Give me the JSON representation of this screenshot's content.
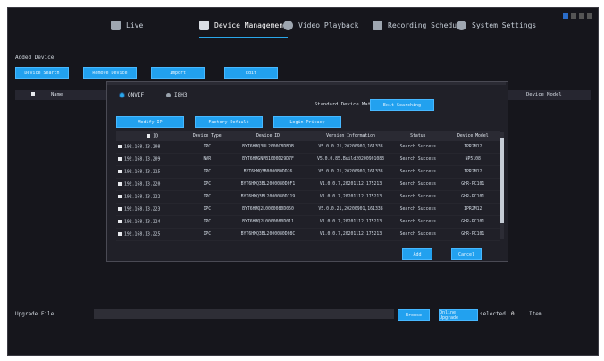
{
  "tabs": [
    {
      "label": "Live",
      "icon": "monitor-icon"
    },
    {
      "label": "Device Management",
      "icon": "grid-icon",
      "active": true
    },
    {
      "label": "Video Playback",
      "icon": "playback-icon"
    },
    {
      "label": "Recording Schedule",
      "icon": "schedule-icon"
    },
    {
      "label": "System Settings",
      "icon": "settings-icon"
    }
  ],
  "section": {
    "title": "Added Device"
  },
  "toolbar": {
    "add_label": "Device Search",
    "remove_label": "Remove Device",
    "import_label": "Import",
    "edit_label": "Edit"
  },
  "table": {
    "name_header": "Name",
    "model_header": "Device Model"
  },
  "bottom": {
    "label": "Upgrade File",
    "browse_label": "Browse",
    "upgrade_label": "Online Upgrade",
    "selected_label": "selected",
    "selected_count": "0",
    "unit": "Item"
  },
  "dialog": {
    "radio_onvif": "ONVIF",
    "radio_i8h": "I8H3",
    "standard_label": "Standard Device Match",
    "exit_label": "Exit Searching",
    "btn_modify_ip": "Modify IP",
    "btn_restore": "Factory Default",
    "btn_activate": "Login Privacy",
    "columns": [
      "ID",
      "Device Type",
      "Device ID",
      "Version Information",
      "Status",
      "Device Model"
    ],
    "rows": [
      [
        "192.168.13.208",
        "IPC",
        "BYT6HMQ3BL2000C8DBOB",
        "V5.0.0.21,20200901,161338",
        "Search Success",
        "IPR2M12"
      ],
      [
        "192.168.13.209",
        "NVR",
        "BYT6HMGNPB1000D29D7F",
        "V5.0.0.85.Build20200901083",
        "Search Success",
        "NP5108"
      ],
      [
        "192.168.13.215",
        "IPC",
        "BYT6HMQ3B0000B0DD26",
        "V5.0.0.21,20200901,161338",
        "Search Success",
        "IPR2M12"
      ],
      [
        "192.168.13.220",
        "IPC",
        "BYT6HMQ3BL2000080D0F1",
        "V1.0.0.7,20201112,175213",
        "Search Success",
        "GHR-PC101"
      ],
      [
        "192.168.13.222",
        "IPC",
        "BYT6HMQ3BL2000080D119",
        "V1.0.0.7,20201112,175213",
        "Search Success",
        "GHR-PC101"
      ],
      [
        "192.168.13.223",
        "IPC",
        "BYT6HMQ2L0000080D050",
        "V5.0.0.21,20200901,161338",
        "Search Success",
        "IPR2M12"
      ],
      [
        "192.168.13.224",
        "IPC",
        "BYT6HMQ2L0000080D011",
        "V1.0.0.7,20201112,175213",
        "Search Success",
        "GHR-PC101"
      ],
      [
        "192.168.13.225",
        "IPC",
        "BYT6HMQ3BL2000080D08C",
        "V1.0.0.7,20201112,175213",
        "Search Success",
        "GHR-PC101"
      ]
    ],
    "ok_label": "Add",
    "cancel_label": "Cancel"
  }
}
